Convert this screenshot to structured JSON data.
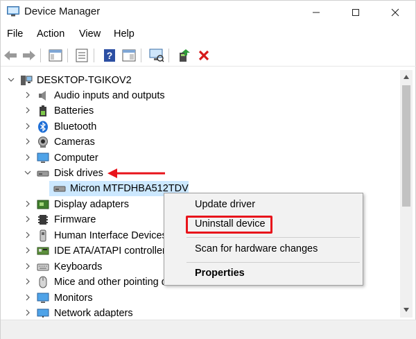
{
  "window": {
    "title": "Device Manager"
  },
  "menu": [
    "File",
    "Action",
    "View",
    "Help"
  ],
  "toolbar": {
    "icons": [
      "back-icon",
      "forward-icon",
      "properties-pane-icon",
      "show-hidden-icon",
      "help-icon",
      "view-icon",
      "scan-monitor-icon",
      "update-driver-icon",
      "uninstall-x-icon"
    ]
  },
  "tree": {
    "root": "DESKTOP-TGIKOV2",
    "items": [
      {
        "label": "Audio inputs and outputs",
        "icon": "speaker-icon",
        "expanded": false
      },
      {
        "label": "Batteries",
        "icon": "battery-icon",
        "expanded": false
      },
      {
        "label": "Bluetooth",
        "icon": "bluetooth-icon",
        "expanded": false
      },
      {
        "label": "Cameras",
        "icon": "camera-icon",
        "expanded": false
      },
      {
        "label": "Computer",
        "icon": "computer-icon",
        "expanded": false
      },
      {
        "label": "Disk drives",
        "icon": "disk-drive-icon",
        "expanded": true
      },
      {
        "label": "Micron MTFDHBA512TDV",
        "icon": "disk-drive-icon",
        "child": true,
        "selected": true
      },
      {
        "label": "Display adapters",
        "icon": "display-adapter-icon",
        "expanded": false
      },
      {
        "label": "Firmware",
        "icon": "firmware-icon",
        "expanded": false
      },
      {
        "label": "Human Interface Devices",
        "icon": "hid-icon",
        "expanded": false
      },
      {
        "label": "IDE ATA/ATAPI controllers",
        "icon": "ide-controller-icon",
        "expanded": false
      },
      {
        "label": "Keyboards",
        "icon": "keyboard-icon",
        "expanded": false
      },
      {
        "label": "Mice and other pointing devices",
        "icon": "mouse-icon",
        "expanded": false
      },
      {
        "label": "Monitors",
        "icon": "monitor-icon",
        "expanded": false
      },
      {
        "label": "Network adapters",
        "icon": "network-adapter-icon",
        "expanded": false
      }
    ]
  },
  "context_menu": {
    "items": [
      "Update driver",
      "Uninstall device",
      "Scan for hardware changes",
      "Properties"
    ],
    "highlighted": "Uninstall device"
  },
  "colors": {
    "selection": "#cce8ff",
    "annotation_red": "#e8141b",
    "menu_bg": "#f2f2f2"
  }
}
